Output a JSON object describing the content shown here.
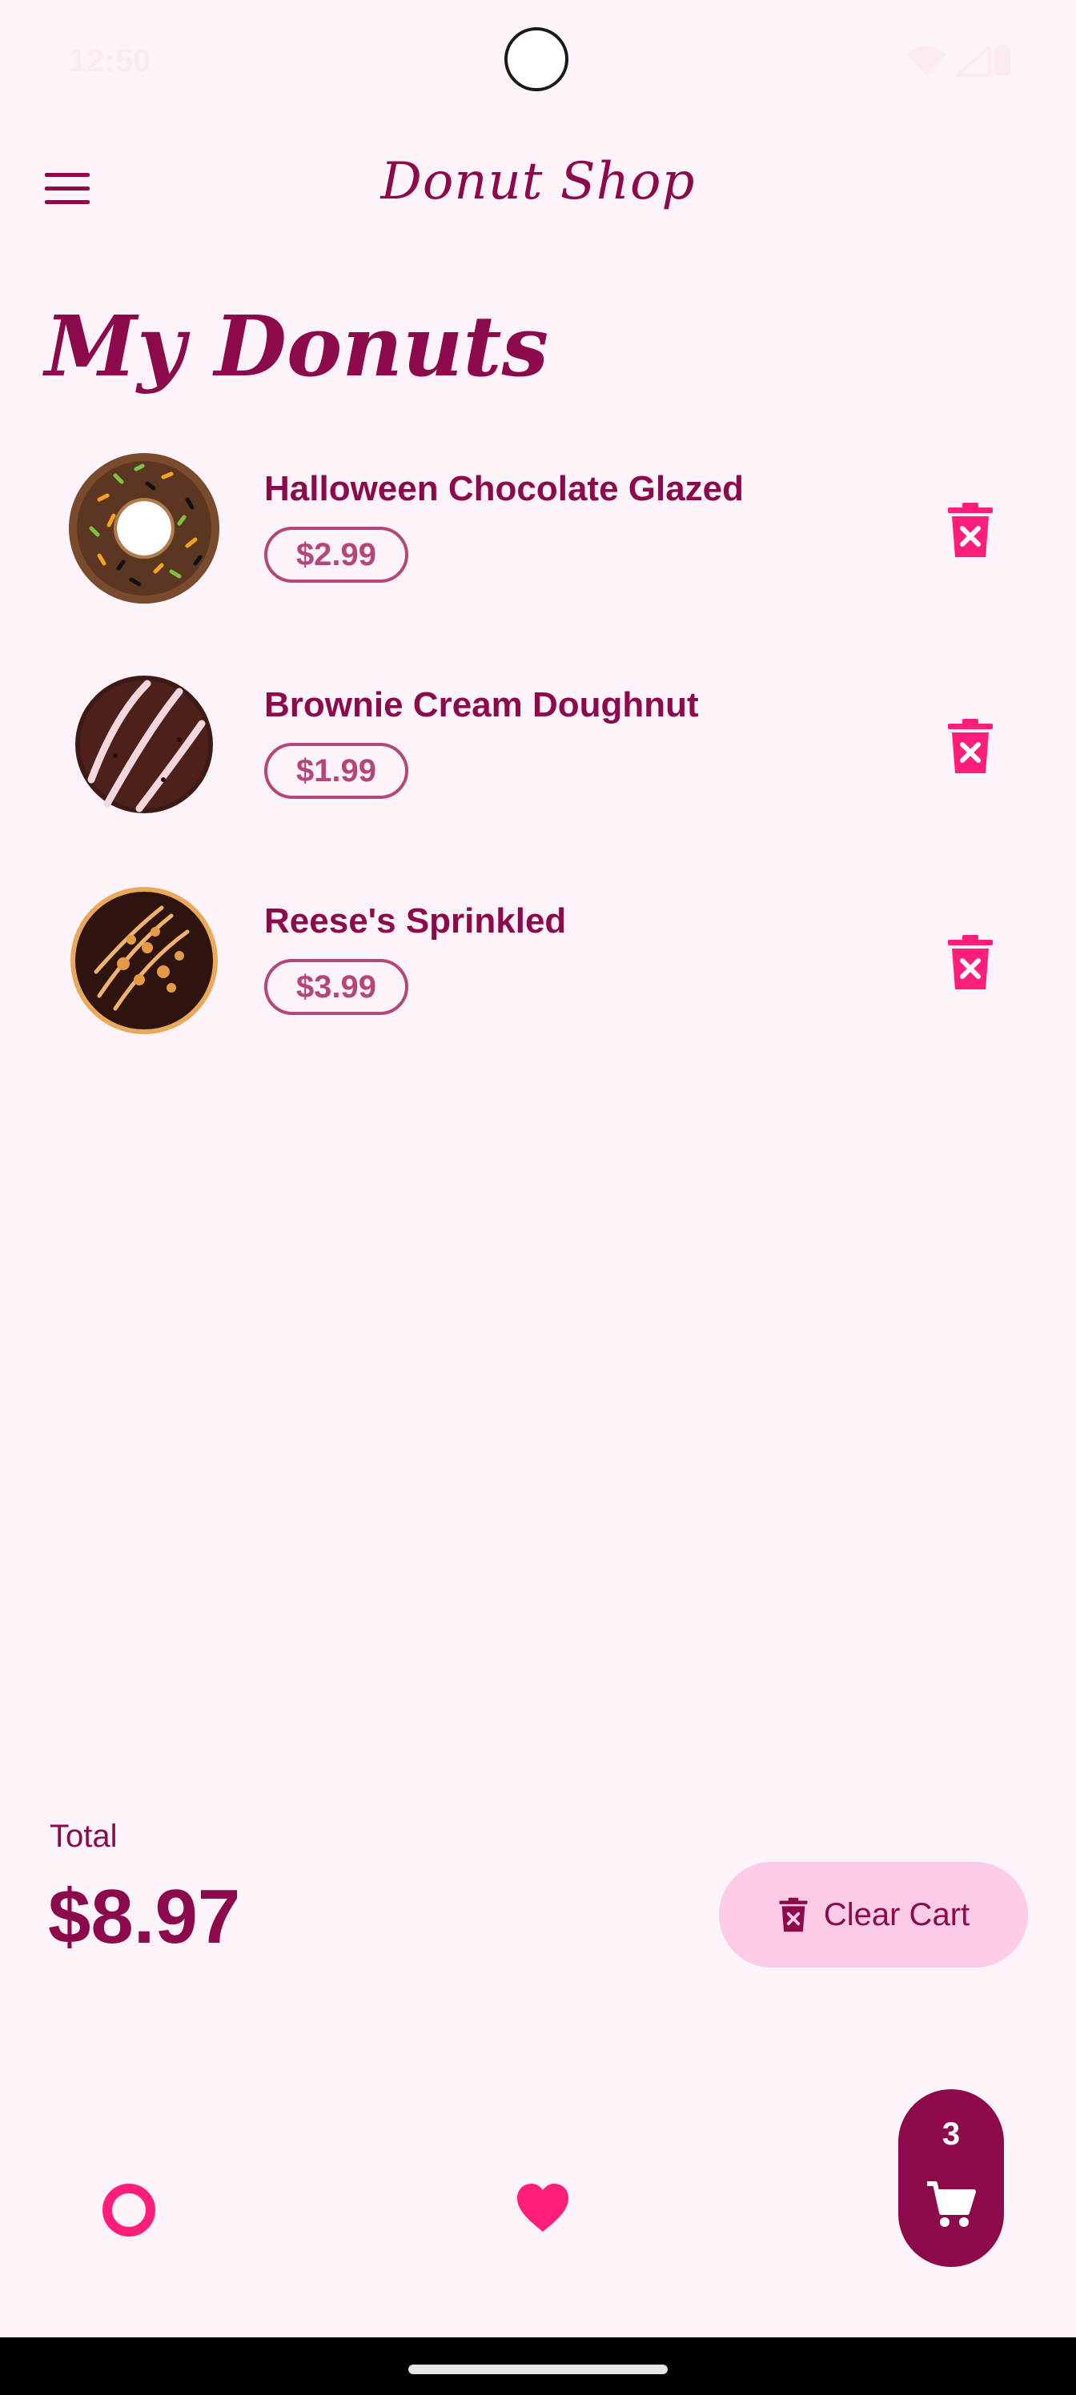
{
  "status_bar": {
    "time": "12:50"
  },
  "app_bar": {
    "title": "Donut Shop",
    "menu_icon": "menu-icon"
  },
  "page": {
    "title": "My Donuts"
  },
  "donuts": [
    {
      "name": "Halloween Chocolate Glazed",
      "price": "$2.99",
      "image": "chocolate-sprinkle-donut"
    },
    {
      "name": "Brownie Cream Doughnut",
      "price": "$1.99",
      "image": "brownie-donut"
    },
    {
      "name": "Reese's Sprinkled",
      "price": "$3.99",
      "image": "peanut-butter-donut"
    }
  ],
  "totals": {
    "label": "Total",
    "value": "$8.97"
  },
  "clear_cart": {
    "label": "Clear Cart",
    "icon": "trash-x-icon"
  },
  "bottom_nav": {
    "cart_count": "3",
    "items": [
      "donut-icon",
      "heart-icon",
      "cart-icon"
    ]
  },
  "colors": {
    "background": "#fdf3fa",
    "primary": "#8c0a4c",
    "accent": "#ff1f7a",
    "chip_border": "#b54679",
    "clear_cart_bg": "#fccce6"
  }
}
